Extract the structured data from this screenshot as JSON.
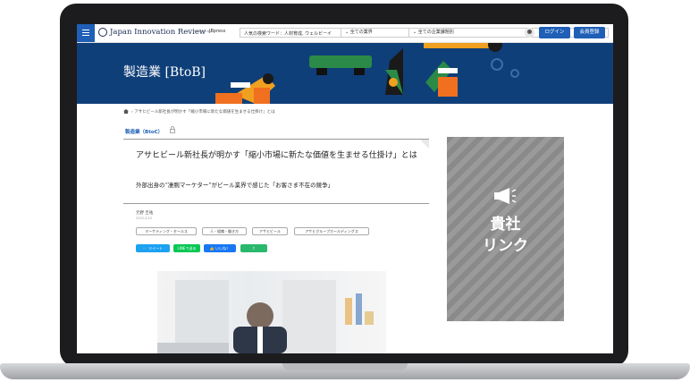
{
  "header": {
    "logo": "Japan Innovation Review",
    "powered_by": "Powered by",
    "partner": "JBpress",
    "search_placeholder": "人気の検索ワード：人材育成, ウェルビーイ",
    "industry_select": "全ての業界",
    "theme_select": "全ての企業課題別",
    "login_label": "ログイン",
    "register_label": "会員登録"
  },
  "banner": {
    "title": "製造業 [BtoB]"
  },
  "breadcrumb": {
    "current": "アサヒビール新社長が明かす「縮小市場に新たな価値を生ませる仕掛け」とは"
  },
  "article": {
    "category": "製造業（BtoC）",
    "title": "アサヒビール新社長が明かす「縮小市場に新たな価値を生ませる仕掛け」とは",
    "subtitle": "外部出身の“凄腕マーケター”がビール業界で感じた「お客さま不在の競争」",
    "author": "元野 圭祐",
    "date": "2023.4.20",
    "tags": [
      "マーケティング・セールス",
      "人・組織・働き方",
      "アサヒビール",
      "アサヒグループホールディングス"
    ],
    "share": {
      "tweet": "ツイート",
      "line": "LINEで送る",
      "like": "いいね！",
      "tumblr": "t"
    }
  },
  "ad": {
    "text_line1": "貴社",
    "text_line2": "リンク"
  },
  "colors": {
    "brand_blue": "#1f5fb6",
    "banner_navy": "#0f3f79",
    "ad_gray": "#8a8a8a"
  }
}
